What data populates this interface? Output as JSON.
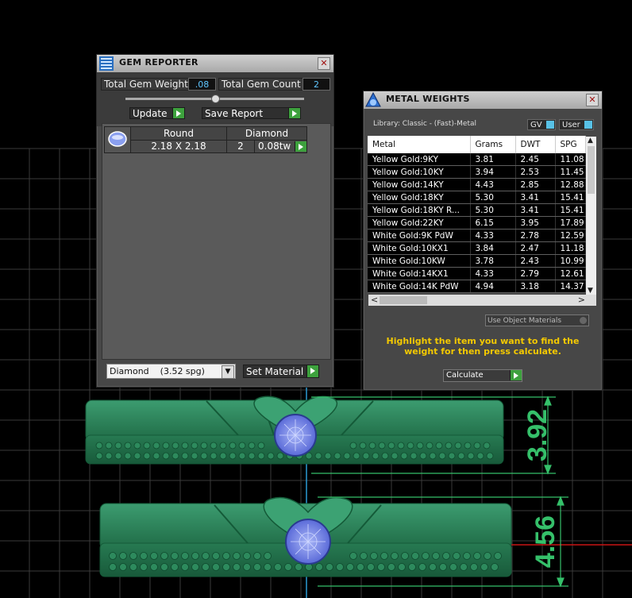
{
  "gem_reporter": {
    "title": "GEM REPORTER",
    "close": "✕",
    "total_weight_label": "Total Gem Weight",
    "total_weight_value": ".08",
    "total_count_label": "Total Gem Count",
    "total_count_value": "2",
    "update_label": "Update",
    "save_report_label": "Save Report",
    "table": {
      "shape": "Round",
      "size": "2.18 X 2.18",
      "material": "Diamond",
      "count": "2",
      "weight": "0.08tw"
    },
    "material_select": "Diamond    (3.52 spg)",
    "set_material_label": "Set Material"
  },
  "metal_weights": {
    "title": "METAL WEIGHTS",
    "close": "✕",
    "library": "Library: Classic - (Fast)-Metal",
    "gv_label": "GV",
    "user_label": "User",
    "columns": [
      "Metal",
      "Grams",
      "DWT",
      "SPG"
    ],
    "rows": [
      [
        "Yellow Gold:9KY",
        "3.81",
        "2.45",
        "11.08"
      ],
      [
        "Yellow Gold:10KY",
        "3.94",
        "2.53",
        "11.45"
      ],
      [
        "Yellow Gold:14KY",
        "4.43",
        "2.85",
        "12.88"
      ],
      [
        "Yellow Gold:18KY",
        "5.30",
        "3.41",
        "15.41"
      ],
      [
        "Yellow Gold:18KY R...",
        "5.30",
        "3.41",
        "15.41"
      ],
      [
        "Yellow Gold:22KY",
        "6.15",
        "3.95",
        "17.89"
      ],
      [
        "White Gold:9K PdW",
        "4.33",
        "2.78",
        "12.59"
      ],
      [
        "White Gold:10KX1",
        "3.84",
        "2.47",
        "11.18"
      ],
      [
        "White Gold:10KW",
        "3.78",
        "2.43",
        "10.99"
      ],
      [
        "White Gold:14KX1",
        "4.33",
        "2.79",
        "12.61"
      ],
      [
        "White Gold:14K PdW",
        "4.94",
        "3.18",
        "14.37"
      ]
    ],
    "use_object_label": "Use Object Materials",
    "instruction": "Highlight the item you want to find the weight for then press calculate.",
    "calculate_label": "Calculate"
  },
  "dimensions": {
    "top": "3.92",
    "bottom": "4.56"
  },
  "colors": {
    "ring_green": "#2f8f60",
    "dim_green": "#35c06a",
    "gem_blue": "#7d8ee8",
    "grid": "#3a3a3a",
    "axis_red": "#c81414"
  }
}
